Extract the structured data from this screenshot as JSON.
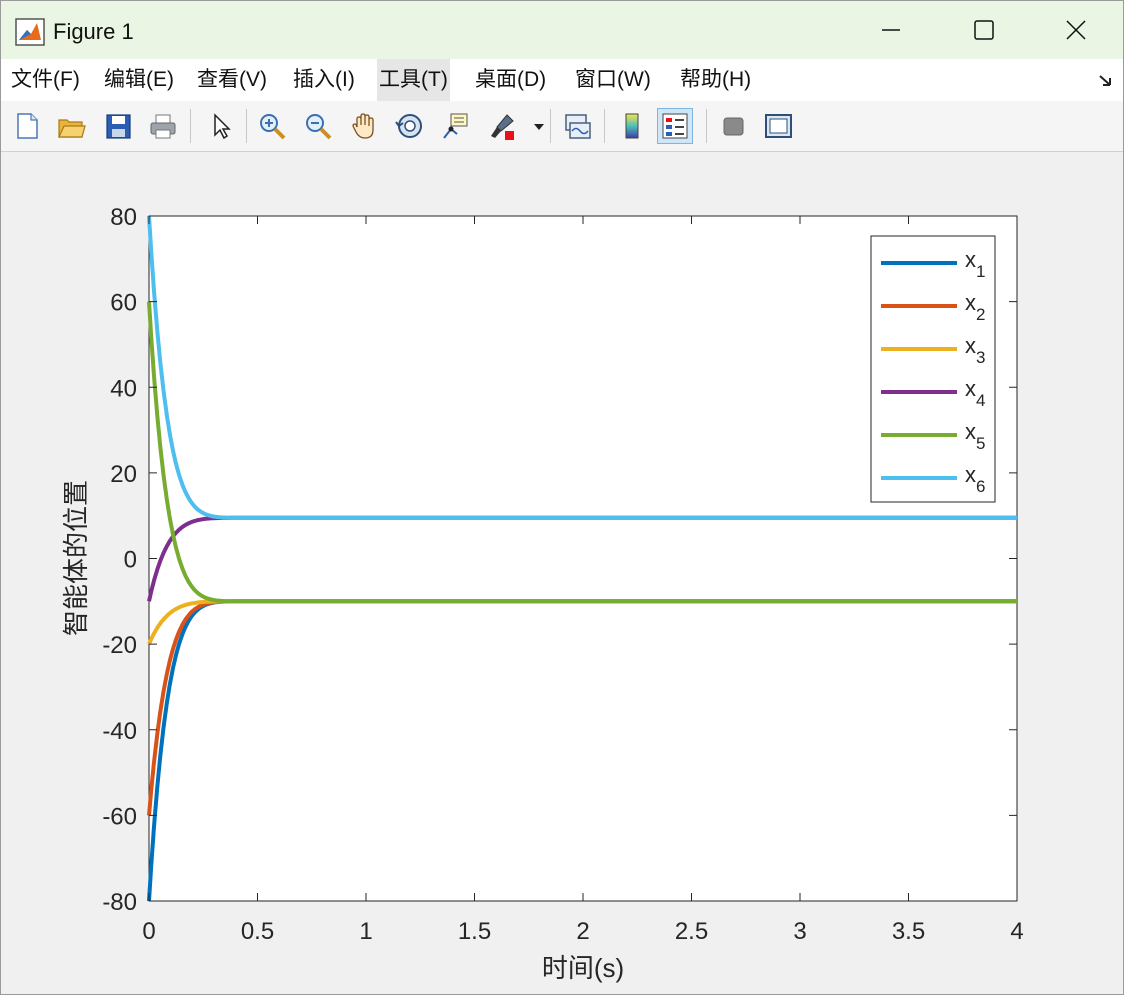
{
  "window": {
    "title": "Figure 1"
  },
  "menu": {
    "items": [
      {
        "label": "文件(F)"
      },
      {
        "label": "编辑(E)"
      },
      {
        "label": "查看(V)"
      },
      {
        "label": "插入(I)"
      },
      {
        "label": "工具(T)"
      },
      {
        "label": "桌面(D)"
      },
      {
        "label": "窗口(W)"
      },
      {
        "label": "帮助(H)"
      }
    ]
  },
  "toolbar": {
    "icons": [
      "new-figure-icon",
      "open-icon",
      "save-icon",
      "print-icon",
      "pointer-icon",
      "zoom-in-icon",
      "zoom-out-icon",
      "pan-hand-icon",
      "rotate-3d-icon",
      "data-cursor-icon",
      "brush-icon",
      "link-plot-icon",
      "colorbar-icon",
      "legend-icon",
      "hide-plot-tools-icon",
      "show-plot-tools-icon"
    ]
  },
  "chart_data": {
    "type": "line",
    "xlabel": "时间(s)",
    "ylabel": "智能体的位置",
    "xlim": [
      0,
      4
    ],
    "ylim": [
      -80,
      80
    ],
    "xticks": [
      "0",
      "0.5",
      "1",
      "1.5",
      "2",
      "2.5",
      "3",
      "3.5",
      "4"
    ],
    "yticks": [
      "80",
      "60",
      "40",
      "20",
      "0",
      "-20",
      "-40",
      "-60",
      "-80"
    ],
    "legend_position": "top-right",
    "series": [
      {
        "name": "x1",
        "color": "#0072BD",
        "initial": -80,
        "final": -10
      },
      {
        "name": "x2",
        "color": "#D95319",
        "initial": -60,
        "final": -10
      },
      {
        "name": "x3",
        "color": "#EDB120",
        "initial": -20,
        "final": -10
      },
      {
        "name": "x4",
        "color": "#7E2F8E",
        "initial": -10,
        "final": 9.5
      },
      {
        "name": "x5",
        "color": "#77AC30",
        "initial": 60,
        "final": -10
      },
      {
        "name": "x6",
        "color": "#4DBEEE",
        "initial": 80,
        "final": 9.5
      }
    ],
    "convergence_time": 0.5
  }
}
